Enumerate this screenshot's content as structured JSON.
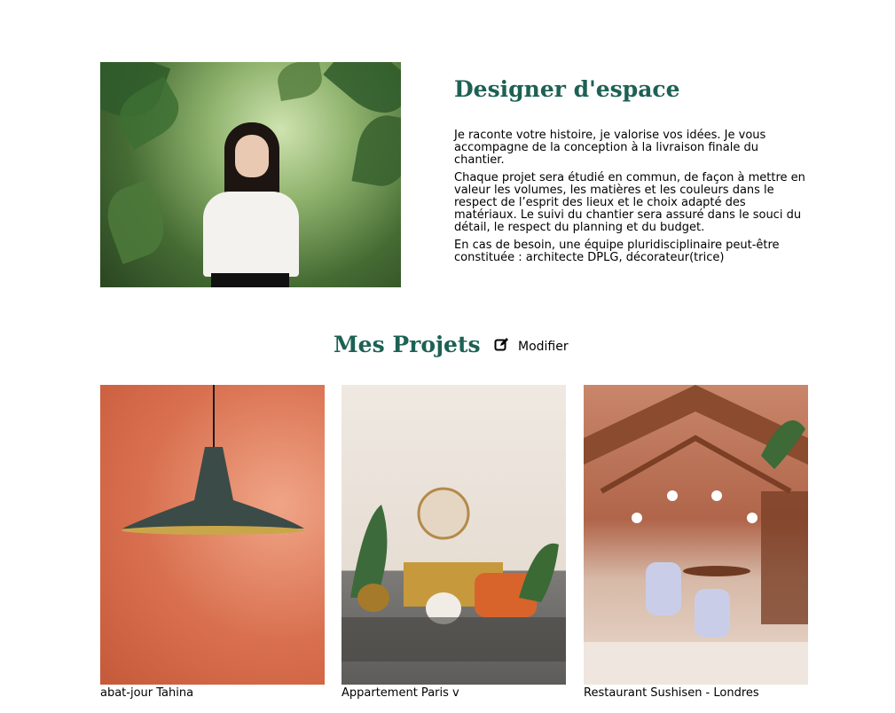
{
  "intro": {
    "title": "Designer d'espace",
    "paragraphs": [
      "Je raconte votre histoire, je valorise vos idées. Je vous accompagne de la conception à la livraison finale du chantier.",
      "Chaque projet sera étudié en commun, de façon à mettre en valeur les volumes, les matières et les couleurs dans le respect de l’esprit des lieux et le choix adapté des matériaux. Le suivi du chantier sera assuré dans le souci du détail, le respect du planning et du budget.",
      "En cas de besoin, une équipe pluridisciplinaire peut-être constituée : architecte DPLG, décorateur(trice)"
    ]
  },
  "projects": {
    "title": "Mes Projets",
    "modify_label": "Modifier",
    "modify_icon": "edit-square-icon",
    "items": [
      {
        "caption": "abat-jour Tahina"
      },
      {
        "caption": "Appartement Paris v"
      },
      {
        "caption": "Restaurant Sushisen - Londres"
      }
    ]
  },
  "colors": {
    "heading": "#1d6154"
  }
}
